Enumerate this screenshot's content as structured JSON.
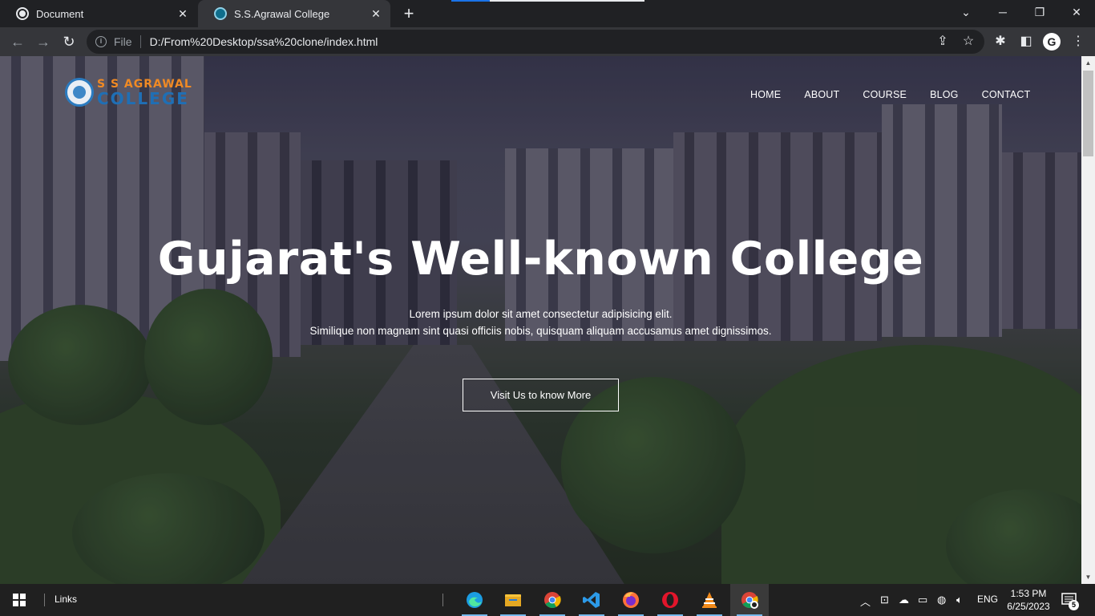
{
  "browser": {
    "tabs": [
      {
        "title": "Document"
      },
      {
        "title": "S.S.Agrawal College"
      }
    ],
    "address": {
      "scheme_label": "File",
      "url": "D:/From%20Desktop/ssa%20clone/index.html"
    },
    "profile_initial": "G"
  },
  "page": {
    "logo": {
      "line1": "S S AGRAWAL",
      "line2": "COLLEGE"
    },
    "nav": [
      "HOME",
      "ABOUT",
      "COURSE",
      "BLOG",
      "CONTACT"
    ],
    "hero": {
      "headline": "Gujarat's Well-known College",
      "subtext_line1": "Lorem ipsum dolor sit amet consectetur adipisicing elit.",
      "subtext_line2": "Similique non magnam sint quasi officiis nobis, quisquam aliquam accusamus amet dignissimos.",
      "cta": "Visit Us to know More"
    }
  },
  "taskbar": {
    "links_label": "Links",
    "apps": [
      "edge-icon",
      "file-explorer-icon",
      "chrome-icon",
      "vscode-icon",
      "firefox-icon",
      "opera-icon",
      "vlc-icon",
      "chrome-profile-icon"
    ],
    "language": "ENG",
    "time": "1:53 PM",
    "date": "6/25/2023",
    "notification_count": "5"
  },
  "colors": {
    "logo_orange": "#f08a24",
    "logo_blue": "#1f6fb5",
    "chrome_dark": "#202124",
    "toolbar": "#35363a"
  }
}
